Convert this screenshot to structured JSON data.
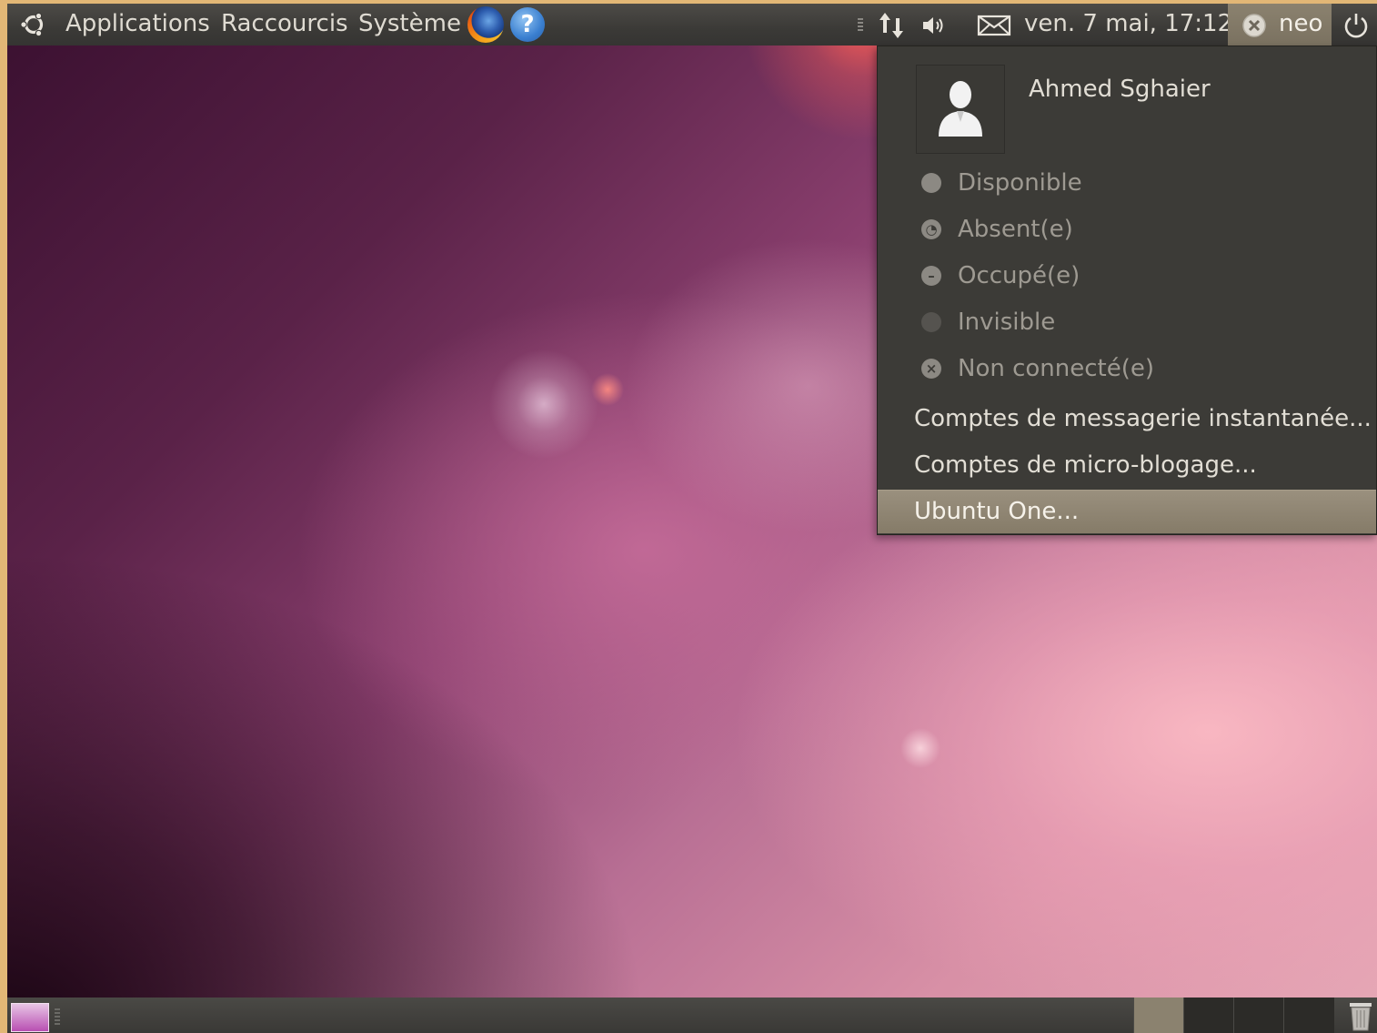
{
  "top_panel": {
    "menus": [
      "Applications",
      "Raccourcis",
      "Système"
    ],
    "clock": "ven.  7 mai, 17:12",
    "user_label": "neo"
  },
  "status_menu": {
    "user_full_name": "Ahmed Sghaier",
    "statuses": [
      {
        "label": "Disponible",
        "icon": "available-icon"
      },
      {
        "label": "Absent(e)",
        "icon": "away-icon"
      },
      {
        "label": "Occupé(e)",
        "icon": "busy-icon"
      },
      {
        "label": "Invisible",
        "icon": "invisible-icon"
      },
      {
        "label": "Non connecté(e)",
        "icon": "offline-icon"
      }
    ],
    "items": [
      {
        "label": "Comptes de messagerie instantanée..."
      },
      {
        "label": "Comptes de micro-blogage..."
      },
      {
        "label": "Ubuntu One..."
      }
    ],
    "highlighted_item": "Ubuntu One..."
  },
  "bottom_panel": {
    "workspaces": 4,
    "active_workspace": 1
  },
  "colors": {
    "panel": "#3b3a37",
    "menu_bg": "#3c3b37",
    "highlight": "#8c826f",
    "frame": "#e2b776"
  }
}
